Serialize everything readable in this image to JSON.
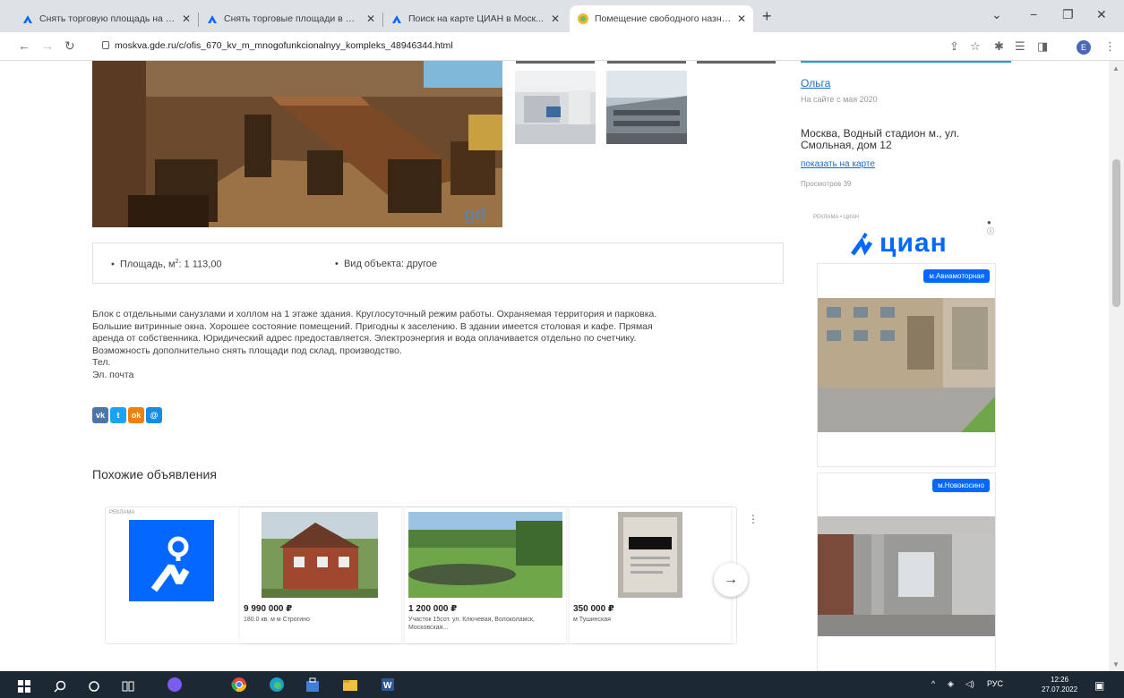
{
  "browser": {
    "tabs": [
      {
        "title": "Снять торговую площадь на ул..."
      },
      {
        "title": "Снять торговые площади в Мос..."
      },
      {
        "title": "Поиск на карте ЦИАН в Моск..."
      },
      {
        "title": "Помещение свободного назна..."
      }
    ],
    "url": "moskva.gde.ru/c/ofis_670_kv_m_mnogofunkcionalnyy_kompleks_48946344.html",
    "profile_initial": "E"
  },
  "listing": {
    "params": {
      "area_label": "Площадь, м",
      "area_sup": "2",
      "area_value": ": 1 113,00",
      "object_type": "Вид объекта: другое"
    },
    "description": [
      "Блок с отдельными санузлами и холлом на 1 этаже здания. Круглосуточный режим работы. Охраняемая территория и парковка.",
      "Большие витринные окна. Хорошее состояние помещений. Пригодны к заселению. В здании имеется столовая и кафе. Прямая",
      "аренда от собственника. Юридический адрес предоставляется. Электроэнергия и вода оплачивается отдельно по счетчику.",
      "Возможность дополнительно снять площади под склад, производство.",
      "Тел.",
      "Эл. почта"
    ],
    "social": [
      "vk",
      "tw",
      "ok",
      "mm"
    ]
  },
  "similar": {
    "title": "Похожие объявления",
    "ad_label": "РЕКЛАМА",
    "cards": [
      {
        "price": "9 990 000 ₽",
        "addr": "180.0 кв. м м Строгино"
      },
      {
        "price": "1 200 000 ₽",
        "addr": "Участок 15сот. ул. Ключевая, Волоколамск, Московская..."
      },
      {
        "price": "350 000 ₽",
        "addr": "м Тушинская"
      }
    ],
    "next_label": "→"
  },
  "seller": {
    "name": "Ольга",
    "since": "На сайте с мая 2020",
    "address": "Москва, Водный стадион м., ул. Смольная, дом 12",
    "map_link": "показать на карте",
    "views": "Просмотров 39"
  },
  "cian_ad": {
    "label": "РЕКЛАМА • ЦИАН",
    "brand": "циан",
    "metro1": "м.Авиамоторная",
    "metro2": "м.Новокосино"
  },
  "taskbar": {
    "lang": "РУС",
    "time": "12:26",
    "date": "27.07.2022"
  },
  "colors": {
    "cian_blue": "#0468ff",
    "link_blue": "#1a6dc9",
    "taskbar": "#1c2833"
  }
}
